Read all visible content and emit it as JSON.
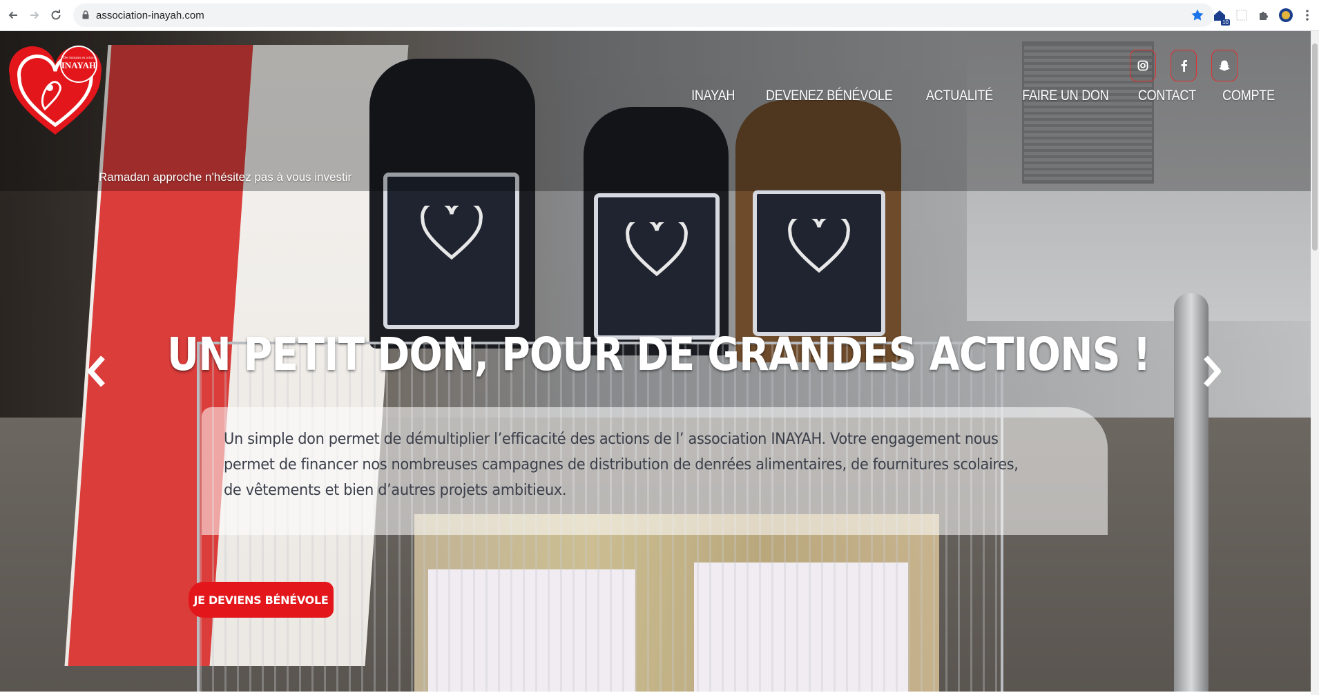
{
  "browser": {
    "url": "association-inayah.com",
    "extension_badge": "10",
    "accent": "#1a73e8"
  },
  "site": {
    "logo_text": "INAYAH",
    "logo_slogan": "Des humains en action",
    "tagline": "Ramadan approche n'hésitez pas à vous investir",
    "brand_color": "#e3161b",
    "socials": [
      {
        "name": "instagram-icon"
      },
      {
        "name": "facebook-icon"
      },
      {
        "name": "snapchat-icon"
      }
    ],
    "nav": [
      "INAYAH",
      "DEVENEZ BÉNÉVOLE",
      "ACTUALITÉ",
      "FAIRE UN DON",
      "CONTACT",
      "COMPTE"
    ]
  },
  "slide": {
    "title": "UN PETIT DON, POUR DE GRANDES ACTIONS !",
    "text": "Un simple don permet de démultiplier l’efficacité des actions de l’ association INAYAH. Votre engagement nous permet de financer nos nombreuses campagnes de distribution de denrées alimentaires, de fournitures scolaires, de vêtements et bien d’autres projets ambitieux.",
    "cta": "JE DEVIENS BÉNÉVOLE"
  }
}
